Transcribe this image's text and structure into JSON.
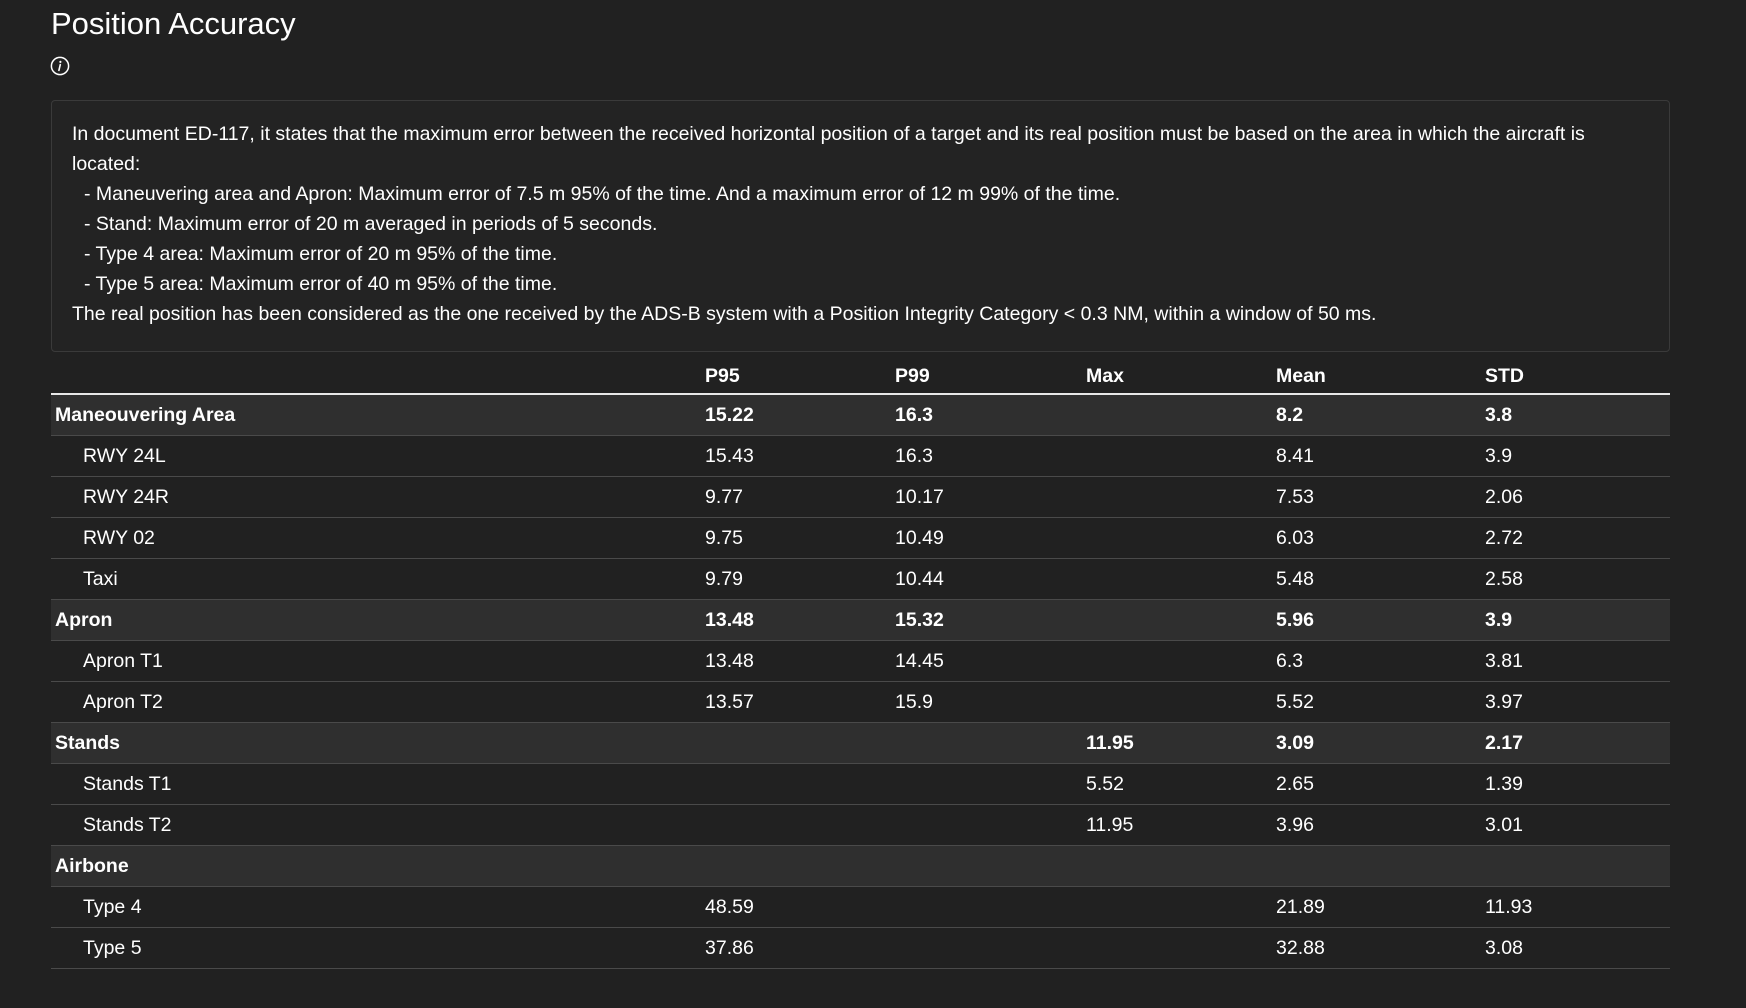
{
  "page": {
    "title": "Position Accuracy",
    "info_icon": "info-circle-icon"
  },
  "description": {
    "intro": "In document ED-117, it states that the maximum error between the received horizontal position of a target and its real position must be based on the area in which the aircraft is located:",
    "bullets": [
      "- Maneuvering area and Apron: Maximum error of 7.5 m 95% of the time. And a maximum error of 12 m 99% of the time.",
      "- Stand: Maximum error of 20 m averaged in periods of 5 seconds.",
      "- Type 4 area: Maximum error of 20 m 95% of the time.",
      "- Type 5 area: Maximum error of 40 m 95% of the time."
    ],
    "footer": "The real position has been considered as the one received by the ADS-B system with a Position Integrity Category < 0.3 NM, within a window of 50 ms."
  },
  "table": {
    "headers": [
      "",
      "P95",
      "P99",
      "Max",
      "Mean",
      "STD"
    ],
    "rows": [
      {
        "kind": "group",
        "cells": [
          "Maneouvering Area",
          "15.22",
          "16.3",
          "",
          "8.2",
          "3.8"
        ]
      },
      {
        "kind": "sub",
        "cells": [
          "RWY 24L",
          "15.43",
          "16.3",
          "",
          "8.41",
          "3.9"
        ]
      },
      {
        "kind": "sub",
        "cells": [
          "RWY 24R",
          "9.77",
          "10.17",
          "",
          "7.53",
          "2.06"
        ]
      },
      {
        "kind": "sub",
        "cells": [
          "RWY 02",
          "9.75",
          "10.49",
          "",
          "6.03",
          "2.72"
        ]
      },
      {
        "kind": "sub",
        "cells": [
          "Taxi",
          "9.79",
          "10.44",
          "",
          "5.48",
          "2.58"
        ]
      },
      {
        "kind": "group",
        "cells": [
          "Apron",
          "13.48",
          "15.32",
          "",
          "5.96",
          "3.9"
        ]
      },
      {
        "kind": "sub",
        "cells": [
          "Apron T1",
          "13.48",
          "14.45",
          "",
          "6.3",
          "3.81"
        ]
      },
      {
        "kind": "sub",
        "cells": [
          "Apron T2",
          "13.57",
          "15.9",
          "",
          "5.52",
          "3.97"
        ]
      },
      {
        "kind": "group",
        "cells": [
          "Stands",
          "",
          "",
          "11.95",
          "3.09",
          "2.17"
        ]
      },
      {
        "kind": "sub",
        "cells": [
          "Stands T1",
          "",
          "",
          "5.52",
          "2.65",
          "1.39"
        ]
      },
      {
        "kind": "sub",
        "cells": [
          "Stands T2",
          "",
          "",
          "11.95",
          "3.96",
          "3.01"
        ]
      },
      {
        "kind": "group",
        "cells": [
          "Airbone",
          "",
          "",
          "",
          "",
          ""
        ]
      },
      {
        "kind": "sub",
        "cells": [
          "Type 4",
          "48.59",
          "",
          "",
          "21.89",
          "11.93"
        ]
      },
      {
        "kind": "sub",
        "cells": [
          "Type 5",
          "37.86",
          "",
          "",
          "32.88",
          "3.08"
        ]
      }
    ]
  }
}
